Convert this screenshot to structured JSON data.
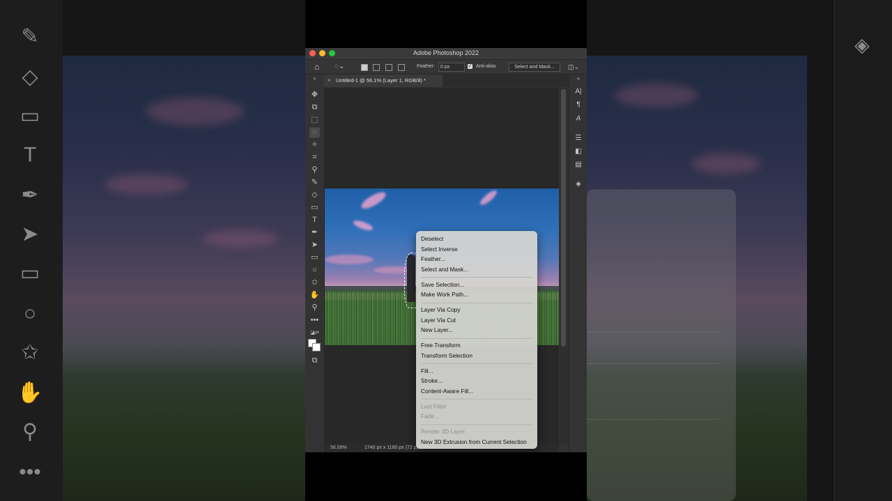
{
  "window": {
    "title": "Adobe Photoshop 2022"
  },
  "options_bar": {
    "feather_label": "Feather:",
    "feather_value": "0 px",
    "anti_alias_label": "Anti-alias",
    "anti_alias_checked": true,
    "select_and_mask_label": "Select and Mask..."
  },
  "document_tab": {
    "title": "Untitled-1 @ 56.1% (Layer 1, RGB/8) *"
  },
  "status_bar": {
    "zoom": "56.09%",
    "doc_info": "1740 px x 1160 px (72 ppi)"
  },
  "context_menu": {
    "groups": [
      [
        {
          "label": "Deselect",
          "enabled": true
        },
        {
          "label": "Select Inverse",
          "enabled": true
        },
        {
          "label": "Feather...",
          "enabled": true
        },
        {
          "label": "Select and Mask...",
          "enabled": true
        }
      ],
      [
        {
          "label": "Save Selection...",
          "enabled": true
        },
        {
          "label": "Make Work Path...",
          "enabled": true
        }
      ],
      [
        {
          "label": "Layer Via Copy",
          "enabled": true
        },
        {
          "label": "Layer Via Cut",
          "enabled": true
        },
        {
          "label": "New Layer...",
          "enabled": true
        }
      ],
      [
        {
          "label": "Free Transform",
          "enabled": true
        },
        {
          "label": "Transform Selection",
          "enabled": true
        }
      ],
      [
        {
          "label": "Fill...",
          "enabled": true
        },
        {
          "label": "Stroke...",
          "enabled": true
        },
        {
          "label": "Content-Aware Fill...",
          "enabled": true
        }
      ],
      [
        {
          "label": "Last Filter",
          "enabled": false
        },
        {
          "label": "Fade...",
          "enabled": false
        }
      ],
      [
        {
          "label": "Render 3D Layer",
          "enabled": false
        },
        {
          "label": "New 3D Extrusion from Current Selection",
          "enabled": true
        }
      ]
    ]
  },
  "tools": [
    "move-tool",
    "artboard-tool",
    "marquee-tool",
    "lasso-tool",
    "magic-wand-tool",
    "crop-tool",
    "eyedropper-tool",
    "brush-tool",
    "eraser-tool",
    "gradient-tool",
    "type-tool",
    "pen-tool",
    "path-selection-tool",
    "rectangle-tool",
    "ellipse-tool",
    "custom-shape-tool",
    "hand-tool",
    "zoom-tool",
    "more-tools"
  ],
  "right_panel_icons": [
    "character-panel-icon",
    "paragraph-panel-icon",
    "glyphs-panel-icon",
    "adjustments-panel-icon",
    "libraries-panel-icon",
    "properties-panel-icon",
    "layers-panel-icon"
  ],
  "colors": {
    "menu_bg": "#d6d6d2",
    "window_bg": "#323232",
    "traffic_red": "#fe5f57",
    "traffic_yellow": "#febc2e",
    "traffic_green": "#28c840"
  }
}
